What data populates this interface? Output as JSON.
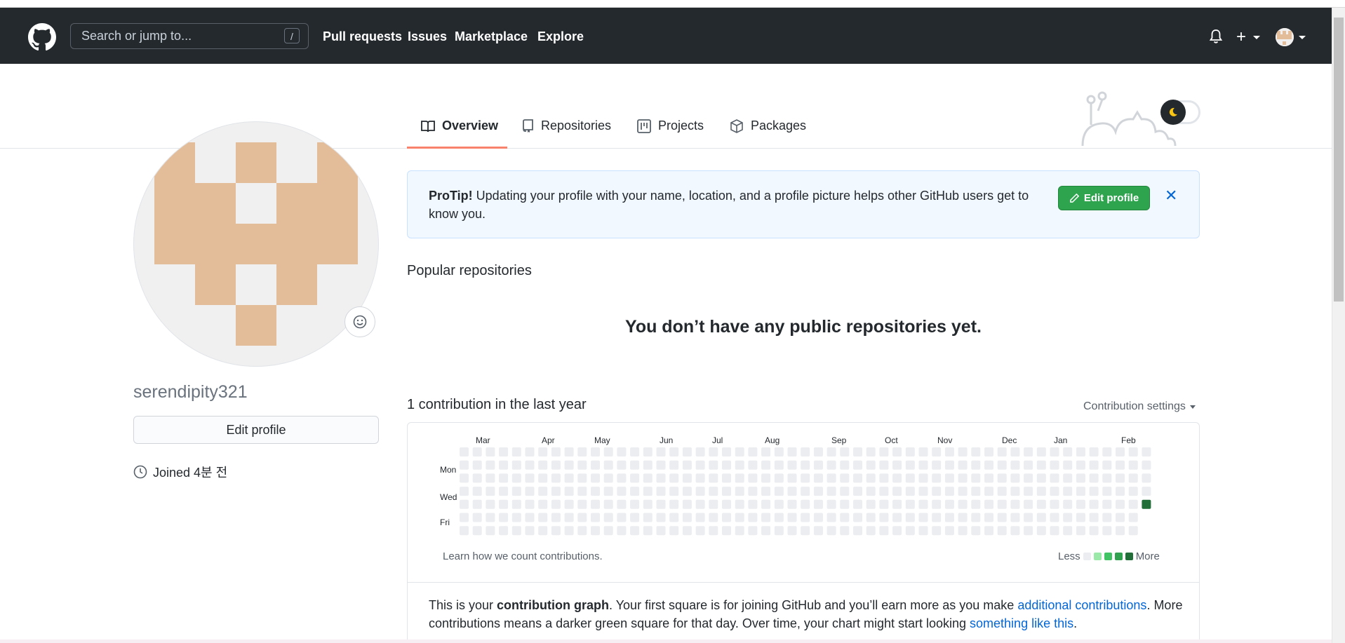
{
  "header": {
    "search_placeholder": "Search or jump to...",
    "search_shortcut": "/",
    "nav": [
      "Pull requests",
      "Issues",
      "Marketplace",
      "Explore"
    ]
  },
  "tabs": [
    "Overview",
    "Repositories",
    "Projects",
    "Packages"
  ],
  "profile": {
    "username": "serendipity321",
    "edit_label": "Edit profile",
    "joined": "Joined 4분 전"
  },
  "protip": {
    "lead": "ProTip!",
    "text": " Updating your profile with your name, location, and a profile picture helps other GitHub users get to know you.",
    "button": "Edit profile",
    "close": "✕"
  },
  "popular": {
    "title": "Popular repositories",
    "empty": "You don’t have any public repositories yet."
  },
  "contributions": {
    "title": "1 contribution in the last year",
    "settings": "Contribution settings",
    "months": [
      "Mar",
      "Apr",
      "May",
      "Jun",
      "Jul",
      "Aug",
      "Sep",
      "Oct",
      "Nov",
      "Dec",
      "Jan",
      "Feb"
    ],
    "days": [
      "Mon",
      "Wed",
      "Fri"
    ],
    "learn": "Learn how we count contributions.",
    "legend_less": "Less",
    "legend_more": "More",
    "colors": [
      "#ebedf0",
      "#9be9a8",
      "#40c463",
      "#30a14e",
      "#216e39"
    ],
    "explain_1": "This is your ",
    "explain_bold": "contribution graph",
    "explain_2": ". Your first square is for joining GitHub and you’ll earn more as you make ",
    "explain_link1": "additional contributions",
    "explain_3": ". More contributions means a darker green square for that day. Over time, your chart might start looking ",
    "explain_link2": "something like this",
    "explain_4": "."
  },
  "icons": {
    "logo": "github-mark-icon",
    "bell": "bell-icon",
    "plus": "plus-icon",
    "overview": "book-icon",
    "repositories": "repo-icon",
    "projects": "project-icon",
    "packages": "package-icon",
    "clock": "clock-icon",
    "pencil": "pencil-icon",
    "smiley": "smiley-icon",
    "theme": "moon-icon"
  }
}
